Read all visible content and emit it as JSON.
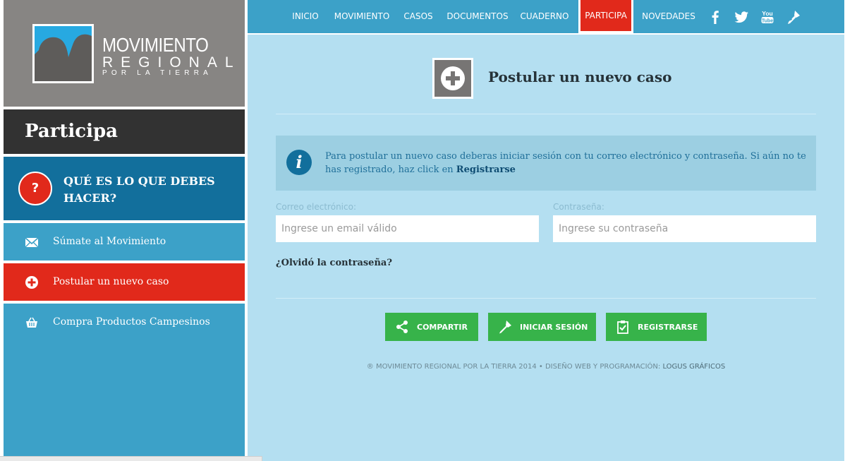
{
  "logo": {
    "line1": "MOVIMIENTO",
    "line2": "REGIONAL",
    "line3": "POR LA TIERRA"
  },
  "sidebar": {
    "title": "Participa",
    "help": {
      "icon_glyph": "?",
      "label": "QUÉ ES LO QUE DEBES HACER?"
    },
    "items": [
      {
        "icon": "envelope-icon",
        "label": "Súmate al Movimiento"
      },
      {
        "icon": "plus-circle-icon",
        "label": "Postular un nuevo caso"
      },
      {
        "icon": "basket-icon",
        "label": "Compra Productos Campesinos"
      }
    ]
  },
  "nav": {
    "items": [
      "INICIO",
      "MOVIMIENTO",
      "CASOS",
      "DOCUMENTOS",
      "CUADERNO",
      "PARTICIPA",
      "NOVEDADES"
    ],
    "active": "PARTICIPA",
    "social": [
      "facebook-icon",
      "twitter-icon",
      "youtube-icon",
      "key-icon"
    ]
  },
  "main": {
    "title": "Postular un nuevo caso",
    "info": {
      "text": "Para postular un nuevo caso deberas iniciar sesión con tu correo electrónico y contraseña. Si aún no te has registrado, haz click en ",
      "link": "Registrarse"
    },
    "email": {
      "label": "Correo electrónico:",
      "placeholder": "Ingrese un email válido",
      "value": ""
    },
    "password": {
      "label": "Contraseña:",
      "placeholder": "Ingrese su contraseña",
      "value": ""
    },
    "forgot": "¿Olvidó la contraseña?",
    "buttons": {
      "share": "COMPARTIR",
      "login": "INICIAR SESIÓN",
      "register": "REGISTRARSE"
    },
    "footer": {
      "text": "® MOVIMIENTO REGIONAL POR LA TIERRA 2014 • DISEÑO WEB Y PROGRAMACIÓN: ",
      "credit": "LOGUS GRÁFICOS"
    }
  },
  "colors": {
    "nav_blue": "#3ca1c8",
    "dark_blue": "#126f9c",
    "red": "#e1291b",
    "green": "#37b34a",
    "panel": "#b4dff1",
    "gray": "#878583",
    "dark": "#323232"
  }
}
